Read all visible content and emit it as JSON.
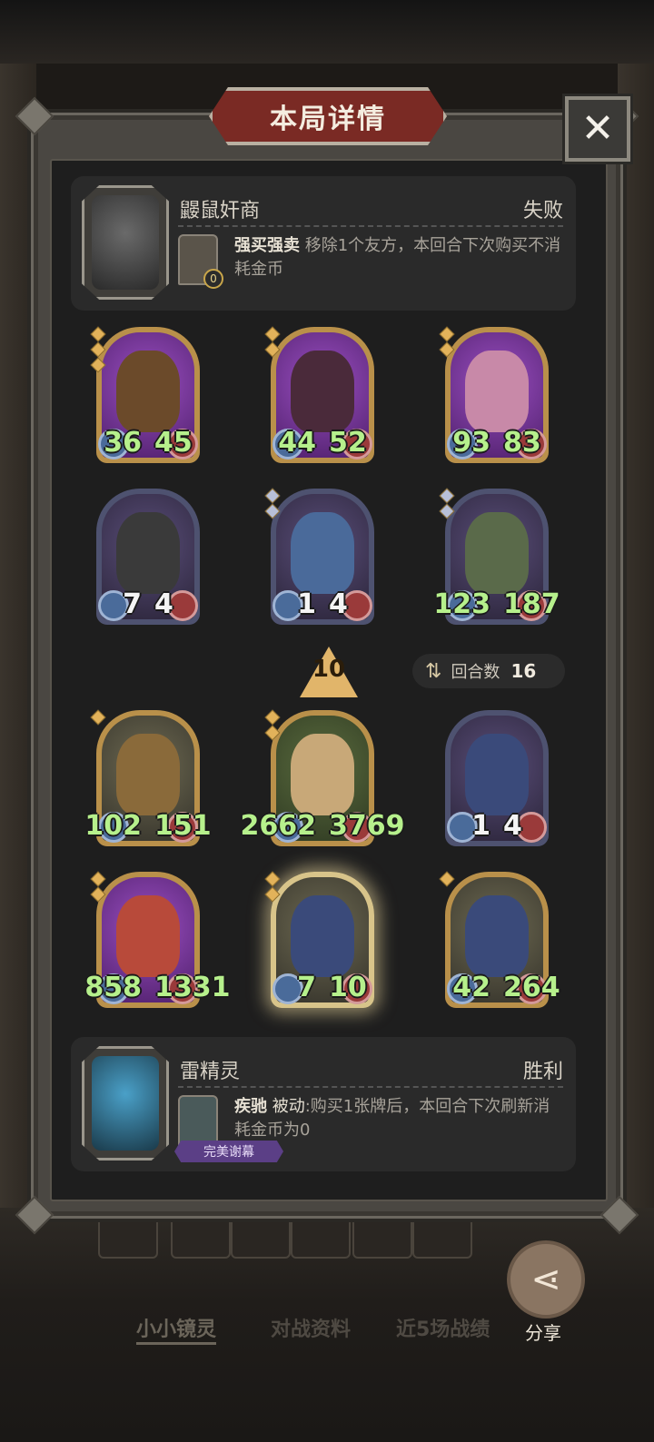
{
  "title": "本局详情",
  "close_icon": "close-icon",
  "opponent": {
    "name": "鼹鼠奸商",
    "result": "失败",
    "skill_name": "强买强卖",
    "skill_desc": "移除1个友方，本回合下次购买不消耗金币",
    "skill_badge": "0"
  },
  "player": {
    "name": "雷精灵",
    "result": "胜利",
    "skill_name": "疾驰",
    "skill_tag": "被动",
    "skill_desc": ":购买1张牌后，本回合下次刷新消耗金币为0",
    "badge": "完美谢幕"
  },
  "opponent_units": [
    {
      "atk": "36",
      "hp": "45"
    },
    {
      "atk": "44",
      "hp": "52"
    },
    {
      "atk": "93",
      "hp": "83"
    },
    {
      "atk": "7",
      "hp": "4"
    },
    {
      "atk": "1",
      "hp": "4"
    },
    {
      "atk": "123",
      "hp": "187"
    }
  ],
  "level": "10",
  "rounds": {
    "label": "回合数",
    "value": "16"
  },
  "player_units": [
    {
      "atk": "102",
      "hp": "151"
    },
    {
      "atk": "2662",
      "hp": "3769"
    },
    {
      "atk": "1",
      "hp": "4"
    },
    {
      "atk": "858",
      "hp": "1331"
    },
    {
      "atk": "7",
      "hp": "10"
    },
    {
      "atk": "42",
      "hp": "264"
    }
  ],
  "bottom_tabs": [
    "小小镜灵",
    "对战资料",
    "近5场战绩"
  ],
  "share": {
    "label": "分享",
    "icon": "share-icon"
  },
  "colors": {
    "accent_gold": "#b9904a",
    "title_red": "#7a2a24",
    "stat_green": "#b6f08c"
  }
}
